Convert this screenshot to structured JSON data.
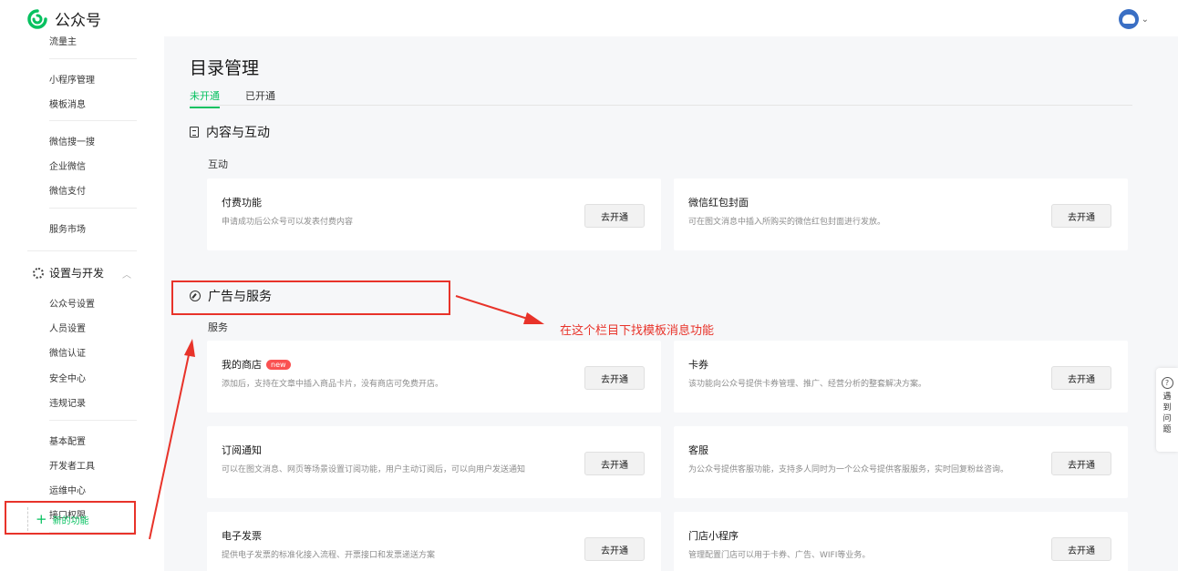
{
  "topbar": {
    "logo_text": "公众号",
    "avatar_chevron": "⌄"
  },
  "sidebar": {
    "items_top": [
      "流量主"
    ],
    "items_group2": [
      "小程序管理",
      "模板消息"
    ],
    "items_group3": [
      "微信搜一搜",
      "企业微信",
      "微信支付"
    ],
    "items_group4": [
      "服务市场"
    ],
    "section_label": "设置与开发",
    "section_chevron": "︿",
    "items_settings": [
      "公众号设置",
      "人员设置",
      "微信认证",
      "安全中心",
      "违规记录"
    ],
    "items_dev": [
      "基本配置",
      "开发者工具",
      "运维中心",
      "接口权限"
    ],
    "new_func_icon": "+",
    "new_func_label": "新的功能"
  },
  "main": {
    "title": "目录管理",
    "tabs": [
      {
        "label": "未开通",
        "active": true
      },
      {
        "label": "已开通",
        "active": false
      }
    ],
    "section1": {
      "title": "内容与互动",
      "subtitle": "互动",
      "cards": [
        {
          "title": "付费功能",
          "desc": "申请成功后公众号可以发表付费内容",
          "button": "去开通"
        },
        {
          "title": "微信红包封面",
          "desc": "可在图文消息中插入所购买的微信红包封面进行发放。",
          "button": "去开通"
        }
      ]
    },
    "section2": {
      "title": "广告与服务",
      "subtitle": "服务",
      "cards": [
        {
          "title": "我的商店",
          "badge": "new",
          "desc": "添加后，支持在文章中插入商品卡片，没有商店可免费开店。",
          "button": "去开通"
        },
        {
          "title": "卡券",
          "desc": "该功能向公众号提供卡券管理、推广、经营分析的整套解决方案。",
          "button": "去开通"
        },
        {
          "title": "订阅通知",
          "desc": "可以在图文消息、网页等场景设置订阅功能，用户主动订阅后，可以向用户发送通知",
          "button": "去开通"
        },
        {
          "title": "客服",
          "desc": "为公众号提供客服功能，支持多人同时为一个公众号提供客服服务，实时回复粉丝咨询。",
          "button": "去开通"
        },
        {
          "title": "电子发票",
          "desc": "提供电子发票的标准化接入流程、开票接口和发票递送方案",
          "button": "去开通"
        },
        {
          "title": "门店小程序",
          "desc": "管理配置门店可以用于卡券、广告、WIFI等业务。",
          "button": "去开通"
        }
      ]
    }
  },
  "annotation": {
    "text": "在这个栏目下找模板消息功能",
    "color": "#e8332a"
  },
  "help_float": {
    "icon": "?",
    "chars": [
      "遇",
      "到",
      "问",
      "题"
    ]
  },
  "colors": {
    "accent": "#07c160",
    "annotation_red": "#e8332a"
  }
}
